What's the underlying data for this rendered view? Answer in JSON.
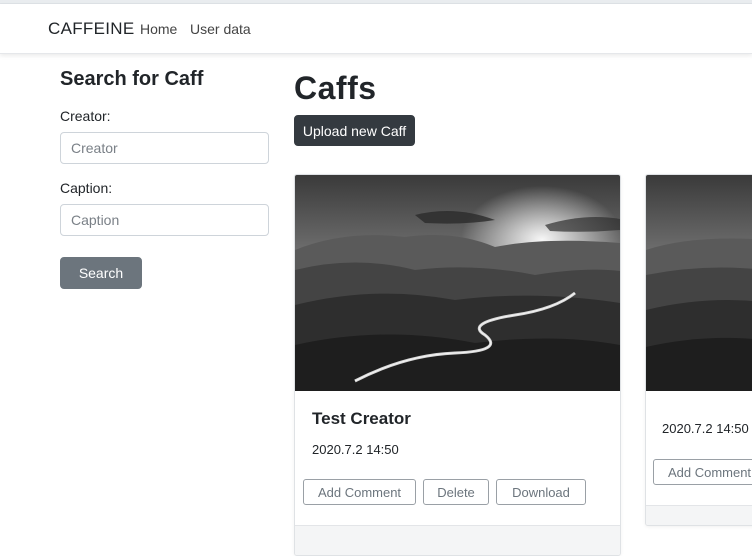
{
  "navbar": {
    "brand": "CAFFEINE",
    "links": [
      {
        "label": "Home"
      },
      {
        "label": "User data"
      }
    ]
  },
  "sidebar": {
    "title": "Search for Caff",
    "creator_label": "Creator:",
    "creator_placeholder": "Creator",
    "creator_value": "",
    "caption_label": "Caption:",
    "caption_placeholder": "Caption",
    "caption_value": "",
    "search_label": "Search"
  },
  "main": {
    "title": "Caffs",
    "upload_label": "Upload new Caff",
    "cards": [
      {
        "creator": "Test Creator",
        "date": "2020.7.2 14:50",
        "add_comment_label": "Add Comment",
        "delete_label": "Delete",
        "download_label": "Download"
      },
      {
        "creator": "",
        "date": "2020.7.2 14:50",
        "add_comment_label": "Add Comment"
      }
    ]
  },
  "colors": {
    "secondary_button": "#6c757d",
    "dark_button": "#343a40",
    "card_footer": "#f4f5f6"
  }
}
